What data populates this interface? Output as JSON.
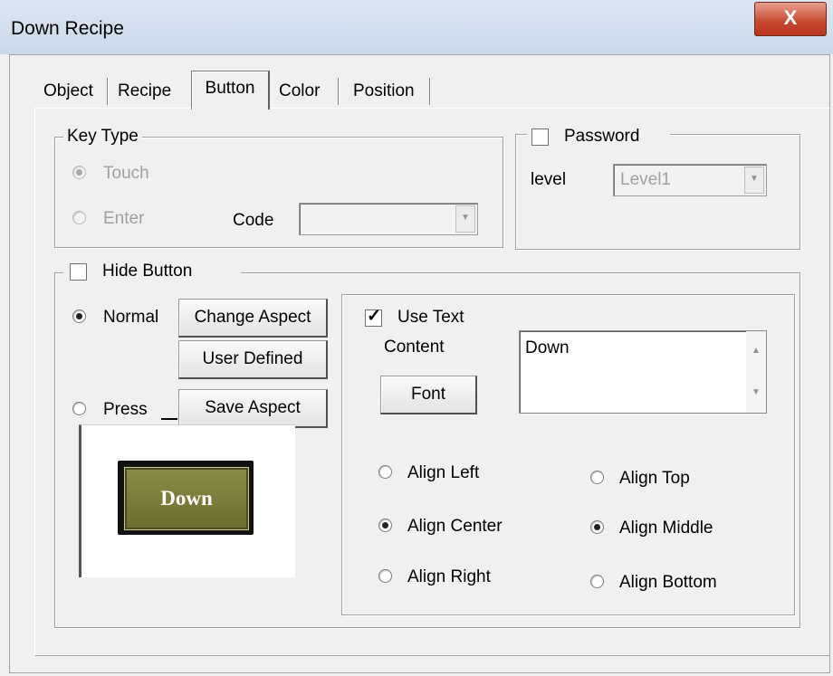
{
  "window": {
    "title": "Down Recipe",
    "close_label": "X"
  },
  "tabs": {
    "object": "Object",
    "recipe": "Recipe",
    "button": "Button",
    "color": "Color",
    "position": "Position"
  },
  "key_type": {
    "group_label": "Key Type",
    "touch_label": "Touch",
    "enter_label": "Enter",
    "code_label": "Code",
    "code_value": "",
    "selected": "Touch"
  },
  "password": {
    "checkbox_label": "Password",
    "checked": false,
    "level_label": "level",
    "level_value": "Level1"
  },
  "hide_button": {
    "checkbox_label": "Hide Button",
    "checked": false,
    "normal_label": "Normal",
    "press_label": "Press",
    "state_selected": "Normal",
    "change_aspect_label": "Change Aspect",
    "user_defined_label": "User Defined",
    "save_aspect_label": "Save Aspect",
    "preview_text": "Down"
  },
  "text_settings": {
    "use_text_label": "Use Text",
    "use_text_checked": true,
    "content_label": "Content",
    "content_value": "Down",
    "font_button_label": "Font",
    "align_left": "Align Left",
    "align_center": "Align Center",
    "align_right": "Align Right",
    "align_top": "Align Top",
    "align_middle": "Align Middle",
    "align_bottom": "Align Bottom",
    "horizontal_selected": "Align Center",
    "vertical_selected": "Align Middle"
  }
}
